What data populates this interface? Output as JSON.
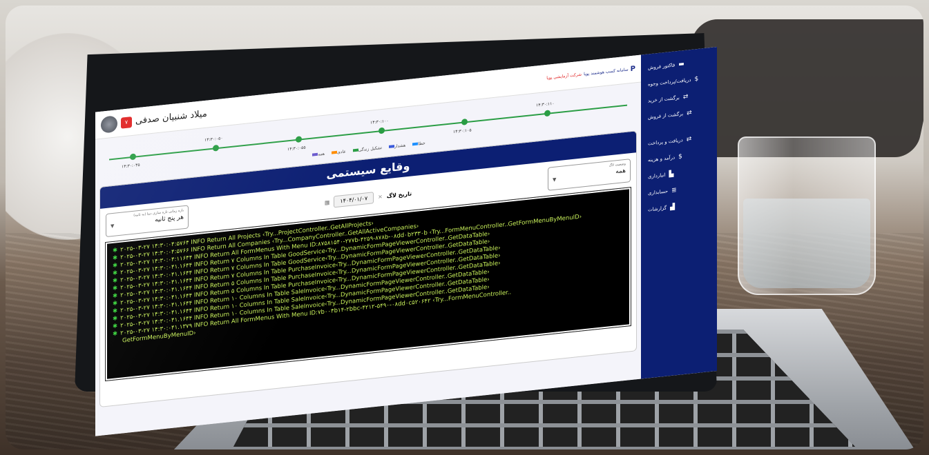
{
  "user": {
    "name": "میلاد شنبیان صدفی",
    "badge": "۷"
  },
  "brand": {
    "title": "سامانه کسب هوشمند پویا",
    "subtitle": "شرکت آزمایشی پویا"
  },
  "sidebar": {
    "items": [
      {
        "label": "فاکتور فروش",
        "icon": "invoice-icon"
      },
      {
        "label": "دریافت/پرداخت وجوه",
        "icon": "dollar-icon"
      },
      {
        "label": "برگشت از خرید",
        "icon": "swap-icon"
      },
      {
        "label": "برگشت از فروش",
        "icon": "swap-icon"
      },
      {
        "label": "دریافت و پرداخت",
        "icon": "swap-icon"
      },
      {
        "label": "درآمد و هزینه",
        "icon": "dollar-icon"
      },
      {
        "label": "انبارداری",
        "icon": "warehouse-icon"
      },
      {
        "label": "حسابداری",
        "icon": "ledger-icon"
      },
      {
        "label": "گزارشات",
        "icon": "chart-icon"
      }
    ]
  },
  "timeline": {
    "dates": [
      "۱۴:۳۰:۰۴۵",
      "۱۴:۳۰:۰۵۰",
      "۱۴:۳۰:۰۵۵",
      "۱۴:۳۰:۱۰۰",
      "۱۴:۳۰:۱۰۵",
      "۱۴:۳۰:۱۱۰"
    ],
    "legend": [
      {
        "label": "همه",
        "color": "#6a5acd"
      },
      {
        "label": "عادی",
        "color": "#ff8c00"
      },
      {
        "label": "تشکیل زندگی",
        "color": "#2a9d44"
      },
      {
        "label": "هشدار",
        "color": "#3b5bdb"
      },
      {
        "label": "خطا",
        "color": "#1e90ff"
      }
    ]
  },
  "panel": {
    "title": "وقایع سیستمی",
    "status_label": "وضعیت لاگ",
    "status_value": "همه",
    "date_label": "تاریخ لاگ",
    "date_value": "۱۴۰۴/۰۱/۰۷",
    "refresh_label": "بازه زمانی تازه سازی دیتا (به ثانیه)",
    "refresh_value": "هر پنج ثانیه"
  },
  "log": [
    "۲۰۲۵-۰۳-۲۷ ۱۴:۳۰:۰۴:۵۷۶۴ INFO Return All Projects ‹Try...ProjectController..GetAllProjects›",
    "۲۰۲۵-۰۳-۲۷ ۱۴:۳۰:۰۴:۵۷۶۶ INFO Return All Companies ‹Try...CompanyController..GetAllActiveCompanies›",
    "۲۰۲۵-۰۳-۲۷ ۱۴:۳۰:۰۴:۱۱۶۴۴ INFO Return All FormMenus With Menu ID:۸۷۵۸۱۵۴۰-۲۷۷b-۴۲۵۹-۸۷۸b-۰۸dd۰b۲۳۳۰b ‹Try...FormMenuController..GetFormMenuByMenuID›",
    "۲۰۲۵-۰۳-۲۷ ۱۴:۳۰:۰۴۱.۱۶۴۴ INFO Return ۷ Columns In Table GoodService‹Try...DynamicFormPageViewerController..GetDataTable›",
    "۲۰۲۵-۰۳-۲۷ ۱۴:۳۰:۰۴۱.۱۶۴۴ INFO Return ۷ Columns In Table GoodService‹Try...DynamicFormPageViewerController..GetDataTable›",
    "۲۰۲۵-۰۳-۲۷ ۱۴:۳۰:۰۴۱.۱۶۴۴ INFO Return ۷ Columns In Table PurchaseInvoice‹Try...DynamicFormPageViewerController..GetDataTable›",
    "۲۰۲۵-۰۳-۲۷ ۱۴:۳۰:۰۴۱.۱۶۴۴ INFO Return ۵ Columns In Table PurchaseInvoice‹Try...DynamicFormPageViewerController..GetDataTable›",
    "۲۰۲۵-۰۳-۲۷ ۱۴:۳۰:۰۴۱.۱۶۴۴ INFO Return ۵ Columns In Table PurchaseInvoice‹Try...DynamicFormPageViewerController..GetDataTable›",
    "۲۰۲۵-۰۳-۲۷ ۱۴:۳۰:۰۴۱.۱۶۴۴ INFO Return ۱۰ Columns In Table SaleInvoice‹Try...DynamicFormPageViewerController..GetDataTable›",
    "۲۰۲۵-۰۳-۲۷ ۱۴:۳۰:۰۴۱.۱۶۴۴ INFO Return ۱۰ Columns In Table SaleInvoice‹Try...DynamicFormPageViewerController..GetDataTable›",
    "۲۰۲۵-۰۳-۲۷ ۱۴:۳۰:۰۴۱.۱۶۴۴ INFO Return ۱۰ Columns In Table SaleInvoice‹Try...DynamicFormPageViewerController..GetDataTable›",
    "۲۰۲۵-۰۳-۲۷ ۱۴:۳۰:۰۴۱.۱۳۷۹ INFO Return All FormMenus With Menu ID:۷b۰۰۴b۱۴-۲bbc-۴۲۱۲-۵۴۹۰-۰۸dd۰c۵۲۰۶۴۲ ‹Try...FormMenuController..",
    "GetFormMenuByMenuID›"
  ],
  "colors": {
    "sidebar": "#0c1f73",
    "accent_green": "#2a9d44",
    "log_text": "#c8f05a",
    "badge": "#e02020"
  }
}
